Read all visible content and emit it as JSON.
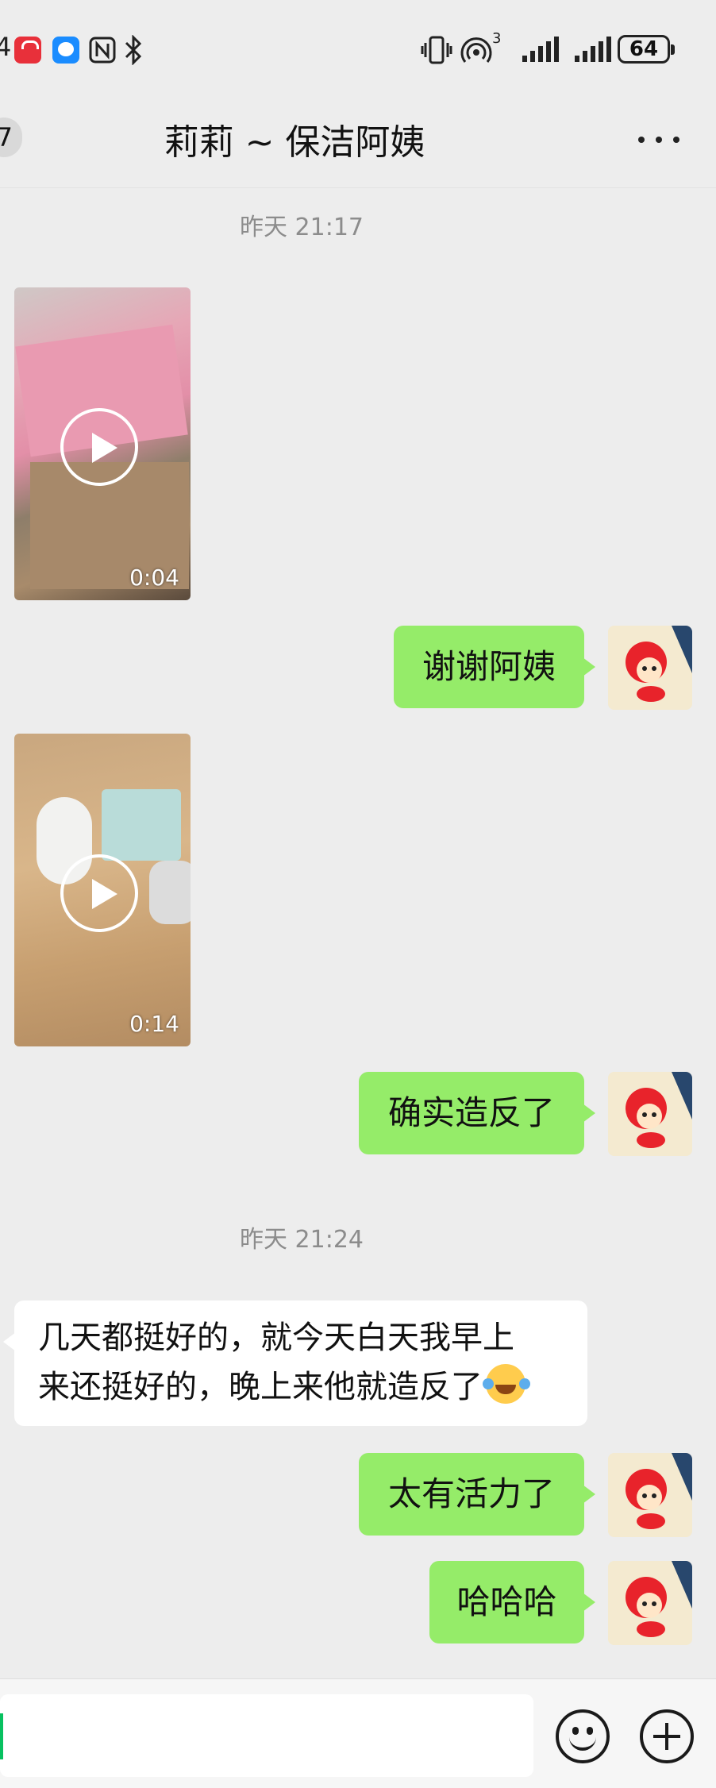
{
  "status_bar": {
    "left_partial": "4",
    "signal_badge": "3",
    "battery": "64"
  },
  "header": {
    "back_count": "7",
    "title": "莉莉 ~ 保洁阿姨"
  },
  "messages": [
    {
      "type": "timestamp",
      "text": "昨天 21:17"
    },
    {
      "type": "video",
      "side": "left",
      "duration": "0:04"
    },
    {
      "type": "text",
      "side": "right",
      "text": "谢谢阿姨"
    },
    {
      "type": "video",
      "side": "left",
      "duration": "0:14"
    },
    {
      "type": "text",
      "side": "right",
      "text": "确实造反了"
    },
    {
      "type": "timestamp",
      "text": "昨天 21:24"
    },
    {
      "type": "text",
      "side": "left",
      "line1": "几天都挺好的，就今天白天我早上",
      "line2": "来还挺好的，晚上来他就造反了"
    },
    {
      "type": "text",
      "side": "right",
      "text": "太有活力了"
    },
    {
      "type": "text",
      "side": "right",
      "text": "哈哈哈"
    }
  ],
  "colors": {
    "chat_bg": "#ededed",
    "outgoing_bubble": "#95ec69",
    "incoming_bubble": "#ffffff",
    "timestamp": "#8c8c8c"
  },
  "icons": {
    "more": "more-dots-icon",
    "emoji": "smiley-icon",
    "plus": "plus-circle-icon"
  }
}
